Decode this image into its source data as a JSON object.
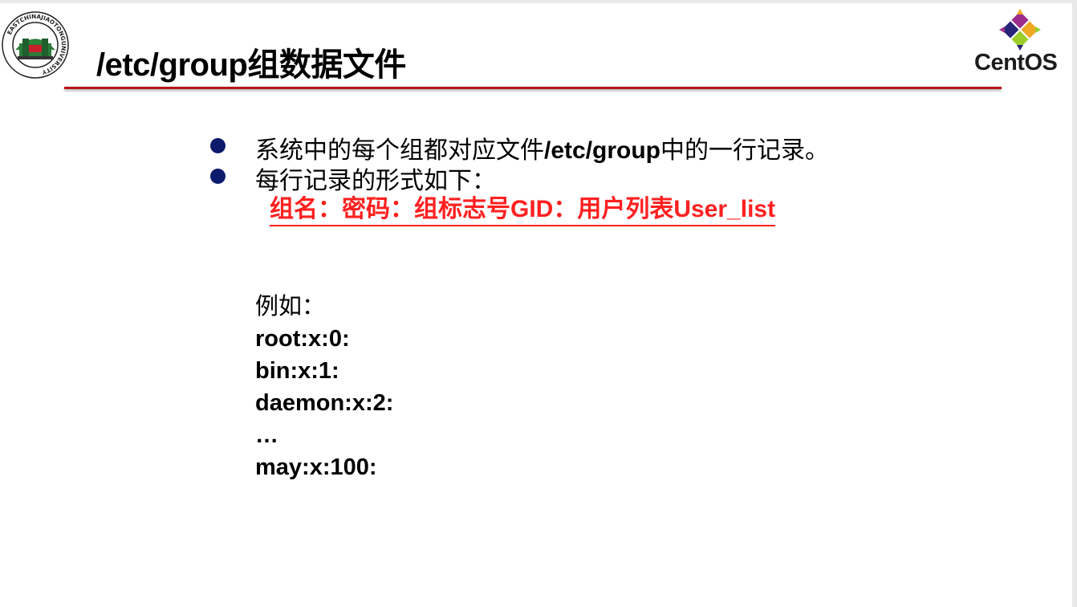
{
  "slide": {
    "title": "/etc/group组数据文件",
    "logo_text": "EASTCHINAJIAOTONGUNIVERSITY",
    "brand": "CentOS"
  },
  "bullets": [
    {
      "pre": "系统中的每个组都对应文件",
      "bold": "/etc/group",
      "post": "中的一行记录。"
    },
    {
      "pre": "每行记录的形式如下：",
      "bold": "",
      "post": ""
    }
  ],
  "format": "组名：密码：组标志号GID：用户列表User_list",
  "example": {
    "label": "例如：",
    "lines": [
      "root:x:0:",
      "bin:x:1:",
      "daemon:x:2:",
      "…",
      "may:x:100:"
    ]
  },
  "colors": {
    "accent_red": "#ff2020",
    "rule_red": "#b8141a",
    "bullet_navy": "#0b1a6b"
  }
}
